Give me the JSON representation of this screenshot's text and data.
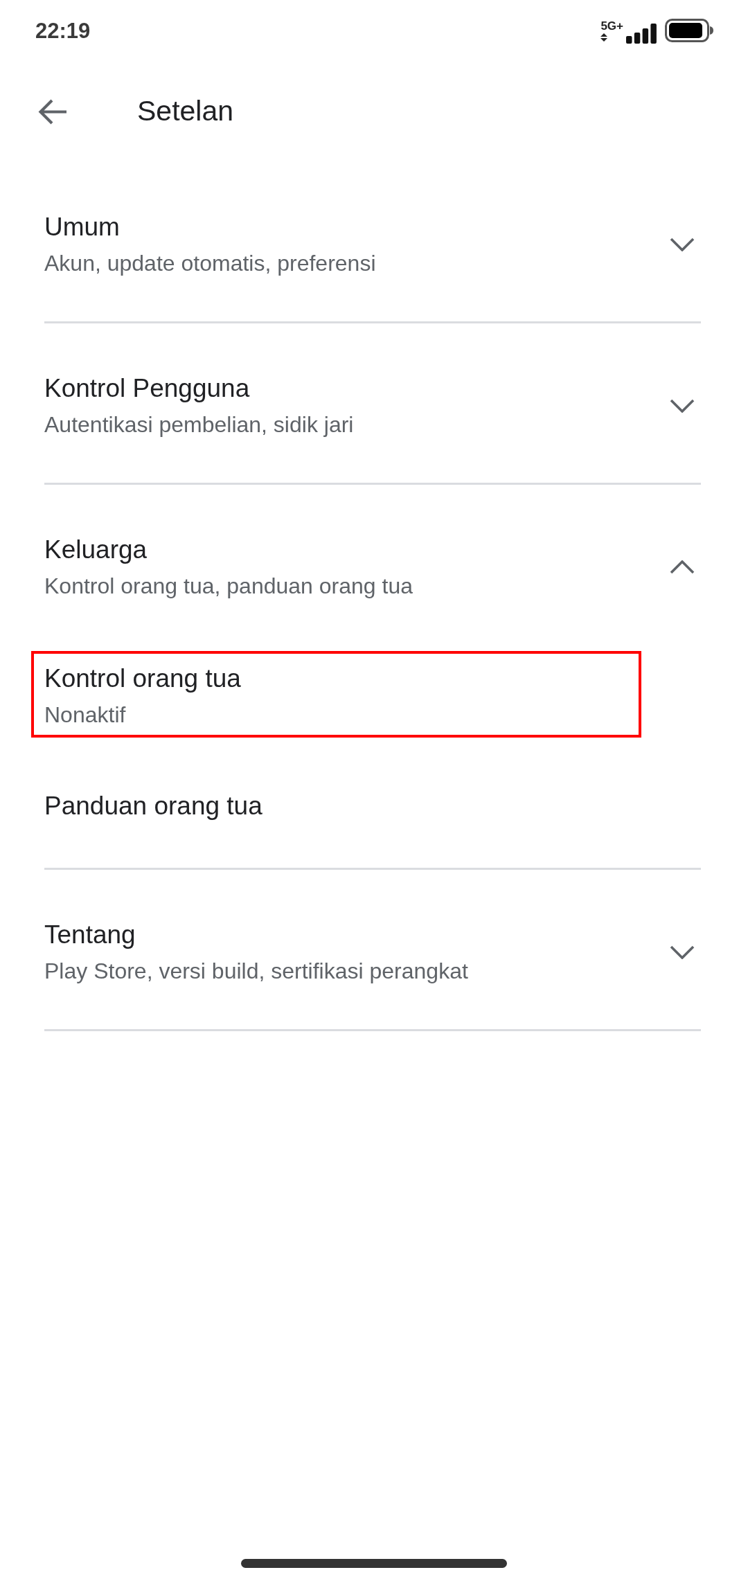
{
  "status_bar": {
    "time": "22:19",
    "network": "5G+"
  },
  "header": {
    "title": "Setelan"
  },
  "sections": [
    {
      "title": "Umum",
      "subtitle": "Akun, update otomatis, preferensi",
      "expanded": false
    },
    {
      "title": "Kontrol Pengguna",
      "subtitle": "Autentikasi pembelian, sidik jari",
      "expanded": false
    },
    {
      "title": "Keluarga",
      "subtitle": "Kontrol orang tua, panduan orang tua",
      "expanded": true,
      "items": [
        {
          "title": "Kontrol orang tua",
          "subtitle": "Nonaktif",
          "highlighted": true
        },
        {
          "title": "Panduan orang tua",
          "highlighted": false
        }
      ]
    },
    {
      "title": "Tentang",
      "subtitle": "Play Store, versi build, sertifikasi perangkat",
      "expanded": false
    }
  ]
}
